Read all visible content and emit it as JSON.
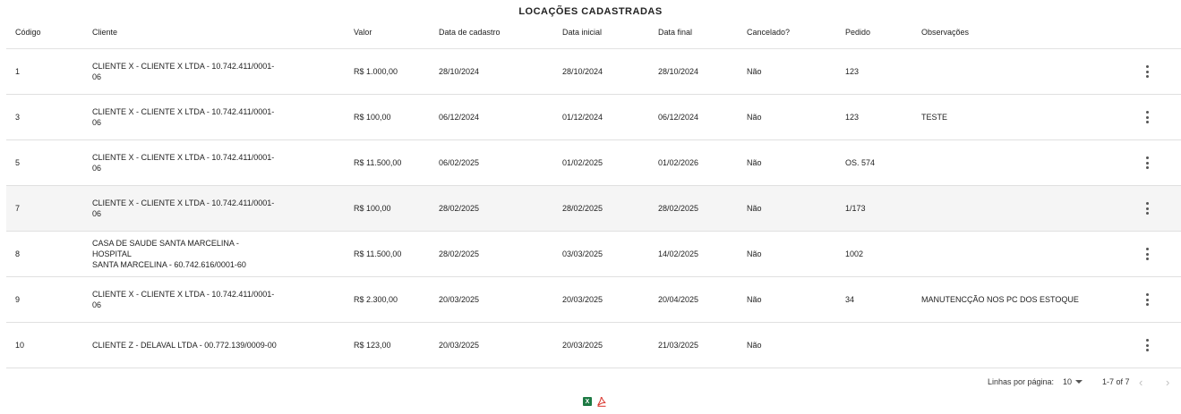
{
  "title": "LOCAÇÕES CADASTRADAS",
  "columns": [
    "Código",
    "Cliente",
    "Valor",
    "Data de cadastro",
    "Data inicial",
    "Data final",
    "Cancelado?",
    "Pedido",
    "Observações"
  ],
  "rows": [
    {
      "codigo": "1",
      "cliente_l1": "CLIENTE X - CLIENTE X LTDA - 10.742.411/0001-",
      "cliente_l2": "06",
      "valor": "R$ 1.000,00",
      "cadastro": "28/10/2024",
      "inicial": "28/10/2024",
      "final": "28/10/2024",
      "cancelado": "Não",
      "pedido": "123",
      "obs": ""
    },
    {
      "codigo": "3",
      "cliente_l1": "CLIENTE X - CLIENTE X LTDA - 10.742.411/0001-",
      "cliente_l2": "06",
      "valor": "R$ 100,00",
      "cadastro": "06/12/2024",
      "inicial": "01/12/2024",
      "final": "06/12/2024",
      "cancelado": "Não",
      "pedido": "123",
      "obs": "TESTE"
    },
    {
      "codigo": "5",
      "cliente_l1": "CLIENTE X - CLIENTE X LTDA - 10.742.411/0001-",
      "cliente_l2": "06",
      "valor": "R$ 11.500,00",
      "cadastro": "06/02/2025",
      "inicial": "01/02/2025",
      "final": "01/02/2026",
      "cancelado": "Não",
      "pedido": "OS. 574",
      "obs": ""
    },
    {
      "codigo": "7",
      "cliente_l1": "CLIENTE X - CLIENTE X LTDA - 10.742.411/0001-",
      "cliente_l2": "06",
      "valor": "R$ 100,00",
      "cadastro": "28/02/2025",
      "inicial": "28/02/2025",
      "final": "28/02/2025",
      "cancelado": "Não",
      "pedido": "1/173",
      "obs": ""
    },
    {
      "codigo": "8",
      "cliente_l1": "CASA DE SAUDE SANTA MARCELINA - HOSPITAL",
      "cliente_l2": "SANTA MARCELINA - 60.742.616/0001-60",
      "valor": "R$ 11.500,00",
      "cadastro": "28/02/2025",
      "inicial": "03/03/2025",
      "final": "14/02/2025",
      "cancelado": "Não",
      "pedido": "1002",
      "obs": ""
    },
    {
      "codigo": "9",
      "cliente_l1": "CLIENTE X - CLIENTE X LTDA - 10.742.411/0001-",
      "cliente_l2": "06",
      "valor": "R$ 2.300,00",
      "cadastro": "20/03/2025",
      "inicial": "20/03/2025",
      "final": "20/04/2025",
      "cancelado": "Não",
      "pedido": "34",
      "obs": "MANUTENCÇÃO NOS PC DOS ESTOQUE"
    },
    {
      "codigo": "10",
      "cliente_l1": "CLIENTE Z - DELAVAL LTDA - 00.772.139/0009-00",
      "cliente_l2": "",
      "valor": "R$ 123,00",
      "cadastro": "20/03/2025",
      "inicial": "20/03/2025",
      "final": "21/03/2025",
      "cancelado": "Não",
      "pedido": "",
      "obs": ""
    }
  ],
  "pagination": {
    "rows_per_page_label": "Linhas por página:",
    "rows_per_page": "10",
    "range": "1-7 of 7",
    "prev": "‹",
    "next": "›"
  },
  "exports": {
    "excel_label": "X",
    "excel_icon": "excel-icon",
    "pdf_icon": "pdf-icon"
  },
  "colors": {
    "header_border": "#e2e2e2",
    "row_border": "#e0e0e0",
    "highlight_row": "#f5f5f5",
    "excel_green": "#1d7a44",
    "pdf_red": "#d9332b"
  }
}
